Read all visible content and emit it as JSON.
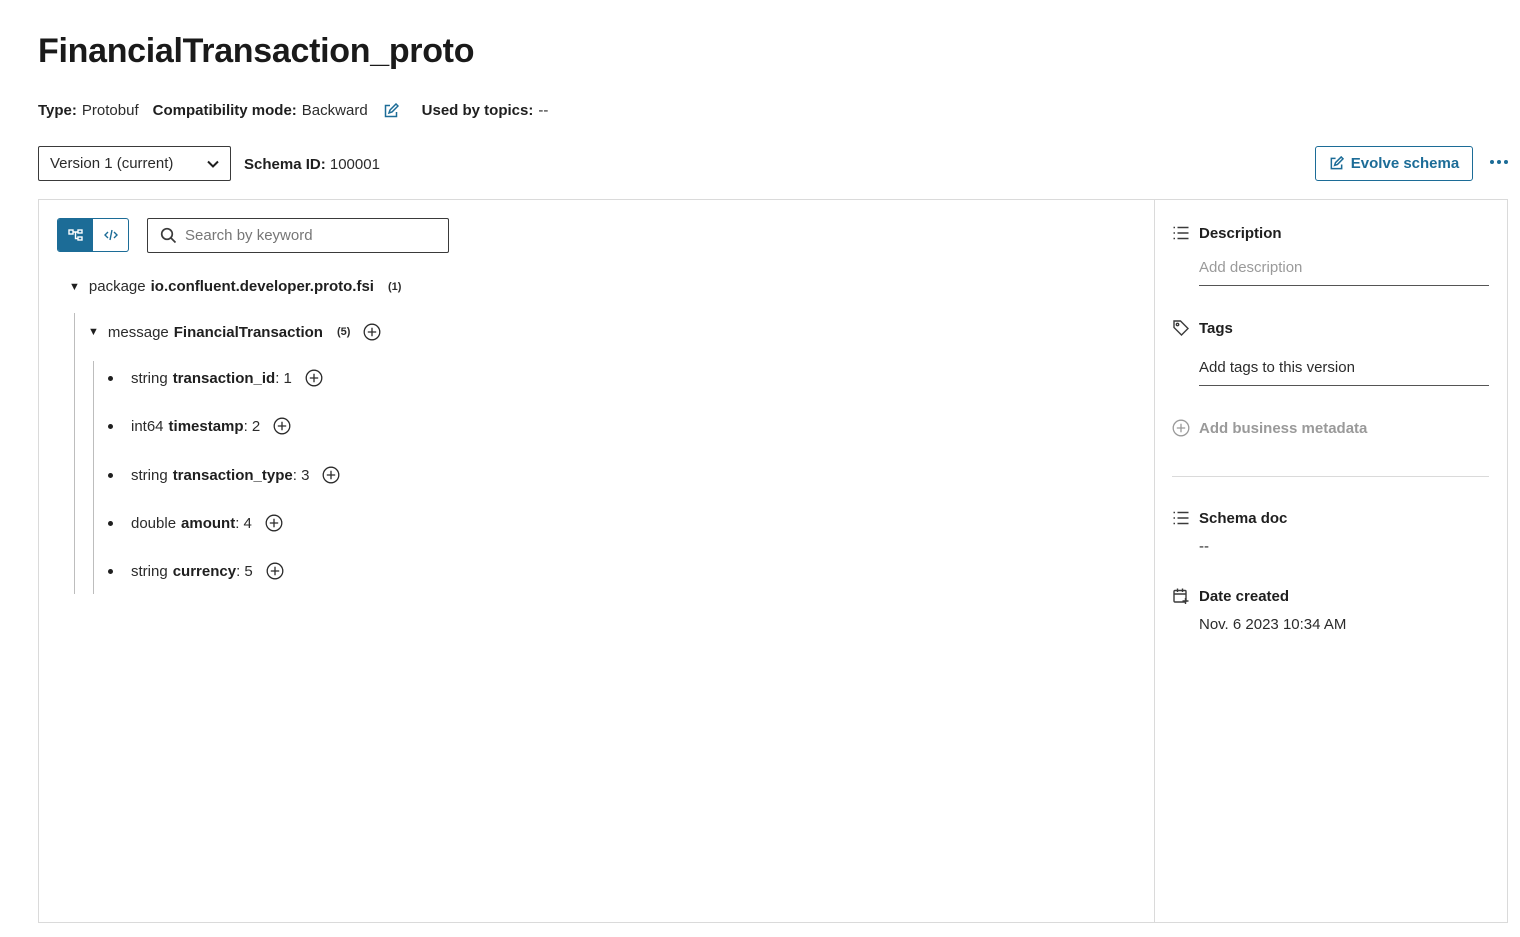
{
  "header": {
    "title": "FinancialTransaction_proto"
  },
  "meta": {
    "type_label": "Type:",
    "type_value": "Protobuf",
    "compat_label": "Compatibility mode:",
    "compat_value": "Backward",
    "topics_label": "Used by topics:",
    "topics_value": "--"
  },
  "toolbar": {
    "version_selected": "Version 1 (current)",
    "schema_id_label": "Schema ID:",
    "schema_id_value": "100001",
    "evolve_label": "Evolve schema"
  },
  "search": {
    "placeholder": "Search by keyword"
  },
  "tree": {
    "package_kw": "package",
    "package_name": "io.confluent.developer.proto.fsi",
    "package_count": "(1)",
    "message_kw": "message",
    "message_name": "FinancialTransaction",
    "message_count": "(5)",
    "fields": [
      {
        "type": "string",
        "name": "transaction_id",
        "num": ": 1"
      },
      {
        "type": "int64",
        "name": "timestamp",
        "num": ": 2"
      },
      {
        "type": "string",
        "name": "transaction_type",
        "num": ": 3"
      },
      {
        "type": "double",
        "name": "amount",
        "num": ": 4"
      },
      {
        "type": "string",
        "name": "currency",
        "num": ": 5"
      }
    ]
  },
  "sidebar": {
    "description_title": "Description",
    "description_placeholder": "Add description",
    "tags_title": "Tags",
    "tags_placeholder": "Add tags to this version",
    "add_metadata_label": "Add business metadata",
    "schema_doc_title": "Schema doc",
    "schema_doc_value": "--",
    "date_created_title": "Date created",
    "date_created_value": "Nov. 6 2023 10:34 AM"
  },
  "colors": {
    "accent": "#1c6c97",
    "text": "#1f1f1f",
    "muted": "#9a9a9a",
    "border": "#dadada"
  }
}
